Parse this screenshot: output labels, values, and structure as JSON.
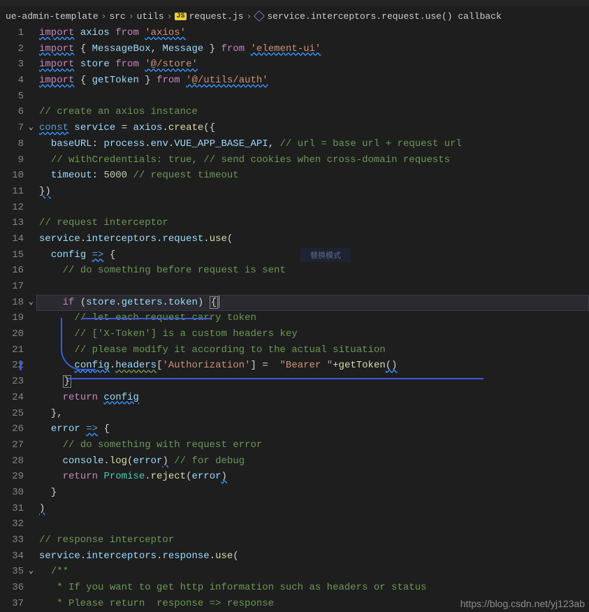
{
  "breadcrumb": {
    "items": [
      "ue-admin-template",
      "src",
      "utils"
    ],
    "file": "request.js",
    "symbol": "service.interceptors.request.use() callback",
    "js_badge": "JS"
  },
  "ghost_hint": "替换模式",
  "watermark": "https://blog.csdn.net/yj123ab",
  "code_lines": [
    {
      "n": 1,
      "segs": [
        {
          "t": "import",
          "c": "kw squiggle"
        },
        {
          "t": " "
        },
        {
          "t": "axios",
          "c": "id"
        },
        {
          "t": " "
        },
        {
          "t": "from",
          "c": "kw"
        },
        {
          "t": " "
        },
        {
          "t": "'axios'",
          "c": "str squiggle"
        }
      ]
    },
    {
      "n": 2,
      "segs": [
        {
          "t": "import",
          "c": "kw squiggle"
        },
        {
          "t": " { "
        },
        {
          "t": "MessageBox",
          "c": "id"
        },
        {
          "t": ", "
        },
        {
          "t": "Message",
          "c": "id"
        },
        {
          "t": " } "
        },
        {
          "t": "from",
          "c": "kw"
        },
        {
          "t": " "
        },
        {
          "t": "'element-ui'",
          "c": "str squiggle"
        }
      ]
    },
    {
      "n": 3,
      "segs": [
        {
          "t": "import",
          "c": "kw squiggle"
        },
        {
          "t": " "
        },
        {
          "t": "store",
          "c": "id"
        },
        {
          "t": " "
        },
        {
          "t": "from",
          "c": "kw"
        },
        {
          "t": " "
        },
        {
          "t": "'@/store'",
          "c": "str squiggle"
        }
      ]
    },
    {
      "n": 4,
      "segs": [
        {
          "t": "import",
          "c": "kw squiggle"
        },
        {
          "t": " { "
        },
        {
          "t": "getToken",
          "c": "id"
        },
        {
          "t": " } "
        },
        {
          "t": "from",
          "c": "kw"
        },
        {
          "t": " "
        },
        {
          "t": "'@/utils/auth'",
          "c": "str squiggle"
        }
      ]
    },
    {
      "n": 5,
      "segs": []
    },
    {
      "n": 6,
      "segs": [
        {
          "t": "// create an axios instance",
          "c": "cmt"
        }
      ]
    },
    {
      "n": 7,
      "fold": true,
      "segs": [
        {
          "t": "const",
          "c": "blueconst squiggle"
        },
        {
          "t": " "
        },
        {
          "t": "service",
          "c": "id"
        },
        {
          "t": " = "
        },
        {
          "t": "axios",
          "c": "id"
        },
        {
          "t": "."
        },
        {
          "t": "create",
          "c": "fn"
        },
        {
          "t": "({"
        }
      ]
    },
    {
      "n": 8,
      "segs": [
        {
          "t": "  "
        },
        {
          "t": "baseURL",
          "c": "prop"
        },
        {
          "t": ": "
        },
        {
          "t": "process",
          "c": "id"
        },
        {
          "t": "."
        },
        {
          "t": "env",
          "c": "prop"
        },
        {
          "t": "."
        },
        {
          "t": "VUE_APP_BASE_API",
          "c": "prop"
        },
        {
          "t": ", "
        },
        {
          "t": "// url = base url + request url",
          "c": "cmt"
        }
      ]
    },
    {
      "n": 9,
      "segs": [
        {
          "t": "  "
        },
        {
          "t": "// withCredentials: true, // send cookies when cross-domain requests",
          "c": "cmt"
        }
      ]
    },
    {
      "n": 10,
      "segs": [
        {
          "t": "  "
        },
        {
          "t": "timeout",
          "c": "prop"
        },
        {
          "t": ": "
        },
        {
          "t": "5000",
          "c": "num"
        },
        {
          "t": " "
        },
        {
          "t": "// request timeout",
          "c": "cmt"
        }
      ]
    },
    {
      "n": 11,
      "segs": [
        {
          "t": "})",
          "c": "op squiggle"
        }
      ]
    },
    {
      "n": 12,
      "segs": []
    },
    {
      "n": 13,
      "segs": [
        {
          "t": "// request interceptor",
          "c": "cmt"
        }
      ]
    },
    {
      "n": 14,
      "segs": [
        {
          "t": "service",
          "c": "id"
        },
        {
          "t": "."
        },
        {
          "t": "interceptors",
          "c": "prop"
        },
        {
          "t": "."
        },
        {
          "t": "request",
          "c": "prop"
        },
        {
          "t": "."
        },
        {
          "t": "use",
          "c": "fn"
        },
        {
          "t": "("
        }
      ]
    },
    {
      "n": 15,
      "segs": [
        {
          "t": "  "
        },
        {
          "t": "config",
          "c": "id"
        },
        {
          "t": " "
        },
        {
          "t": "=>",
          "c": "blueconst squiggle"
        },
        {
          "t": " {"
        }
      ]
    },
    {
      "n": 16,
      "segs": [
        {
          "t": "    "
        },
        {
          "t": "// do something before request is sent",
          "c": "cmt"
        }
      ]
    },
    {
      "n": 17,
      "segs": []
    },
    {
      "n": 18,
      "fold": true,
      "hl": true,
      "segs": [
        {
          "t": "    "
        },
        {
          "t": "if",
          "c": "kw"
        },
        {
          "t": " ("
        },
        {
          "t": "store",
          "c": "id"
        },
        {
          "t": "."
        },
        {
          "t": "getters",
          "c": "prop"
        },
        {
          "t": "."
        },
        {
          "t": "token",
          "c": "prop"
        },
        {
          "t": ") "
        },
        {
          "t": "{",
          "c": "op bracket-box"
        },
        {
          "t": "",
          "cursor": true
        }
      ]
    },
    {
      "n": 19,
      "segs": [
        {
          "t": "      "
        },
        {
          "t": "// let each request carry token",
          "c": "cmt"
        }
      ]
    },
    {
      "n": 20,
      "segs": [
        {
          "t": "      "
        },
        {
          "t": "// ['X-Token'] is a custom headers key",
          "c": "cmt"
        }
      ]
    },
    {
      "n": 21,
      "segs": [
        {
          "t": "      "
        },
        {
          "t": "// please modify it according to the actual situation",
          "c": "cmt"
        }
      ]
    },
    {
      "n": 22,
      "mark": true,
      "segs": [
        {
          "t": "      "
        },
        {
          "t": "config",
          "c": "id squiggle"
        },
        {
          "t": "."
        },
        {
          "t": "headers",
          "c": "prop squiggle-g"
        },
        {
          "t": "["
        },
        {
          "t": "'Authorization'",
          "c": "str"
        },
        {
          "t": "] =  "
        },
        {
          "t": "\"Bearer \"",
          "c": "str"
        },
        {
          "t": "+"
        },
        {
          "t": "getToken",
          "c": "fn"
        },
        {
          "t": "()",
          "c": "op squiggle"
        }
      ]
    },
    {
      "n": 23,
      "segs": [
        {
          "t": "    "
        },
        {
          "t": "}",
          "c": "op bracket-box"
        }
      ]
    },
    {
      "n": 24,
      "segs": [
        {
          "t": "    "
        },
        {
          "t": "return",
          "c": "kw"
        },
        {
          "t": " "
        },
        {
          "t": "config",
          "c": "id squiggle"
        }
      ]
    },
    {
      "n": 25,
      "segs": [
        {
          "t": "  },"
        }
      ]
    },
    {
      "n": 26,
      "segs": [
        {
          "t": "  "
        },
        {
          "t": "error",
          "c": "id"
        },
        {
          "t": " "
        },
        {
          "t": "=>",
          "c": "blueconst squiggle"
        },
        {
          "t": " {"
        }
      ]
    },
    {
      "n": 27,
      "segs": [
        {
          "t": "    "
        },
        {
          "t": "// do something with request error",
          "c": "cmt"
        }
      ]
    },
    {
      "n": 28,
      "segs": [
        {
          "t": "    "
        },
        {
          "t": "console",
          "c": "id"
        },
        {
          "t": "."
        },
        {
          "t": "log",
          "c": "fn"
        },
        {
          "t": "("
        },
        {
          "t": "error",
          "c": "id"
        },
        {
          "t": ")",
          "c": "op squiggle"
        },
        {
          "t": " "
        },
        {
          "t": "// for debug",
          "c": "cmt"
        }
      ]
    },
    {
      "n": 29,
      "segs": [
        {
          "t": "    "
        },
        {
          "t": "return",
          "c": "kw"
        },
        {
          "t": " "
        },
        {
          "t": "Promise",
          "c": "cls"
        },
        {
          "t": "."
        },
        {
          "t": "reject",
          "c": "fn"
        },
        {
          "t": "("
        },
        {
          "t": "error",
          "c": "id"
        },
        {
          "t": ")",
          "c": "op squiggle"
        }
      ]
    },
    {
      "n": 30,
      "segs": [
        {
          "t": "  }"
        }
      ]
    },
    {
      "n": 31,
      "segs": [
        {
          "t": ")",
          "c": "op squiggle"
        }
      ]
    },
    {
      "n": 32,
      "segs": []
    },
    {
      "n": 33,
      "segs": [
        {
          "t": "// response interceptor",
          "c": "cmt"
        }
      ]
    },
    {
      "n": 34,
      "segs": [
        {
          "t": "service",
          "c": "id"
        },
        {
          "t": "."
        },
        {
          "t": "interceptors",
          "c": "prop"
        },
        {
          "t": "."
        },
        {
          "t": "response",
          "c": "prop"
        },
        {
          "t": "."
        },
        {
          "t": "use",
          "c": "fn"
        },
        {
          "t": "("
        }
      ]
    },
    {
      "n": 35,
      "fold": true,
      "segs": [
        {
          "t": "  "
        },
        {
          "t": "/**",
          "c": "cmt"
        }
      ]
    },
    {
      "n": 36,
      "segs": [
        {
          "t": "   * If you want to get http information such as headers or status",
          "c": "cmt"
        }
      ]
    },
    {
      "n": 37,
      "segs": [
        {
          "t": "   * Please return  response => response",
          "c": "cmt"
        }
      ]
    }
  ]
}
